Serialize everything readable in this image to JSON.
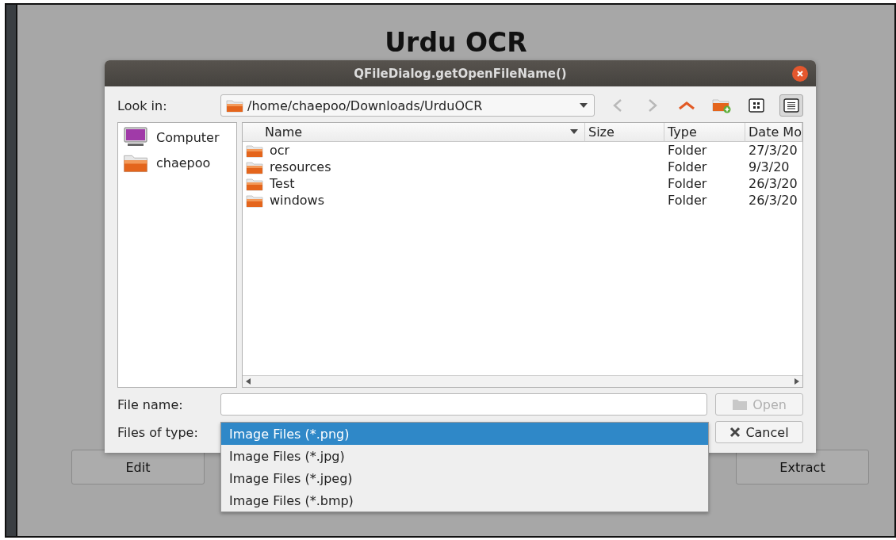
{
  "app": {
    "title": "Urdu OCR",
    "buttons": [
      {
        "label": "Edit"
      },
      {
        "label": "Extract"
      }
    ]
  },
  "dialog": {
    "title": "QFileDialog.getOpenFileName()",
    "look_in": {
      "label": "Look in:",
      "path": "/home/chaepoo/Downloads/UrduOCR"
    },
    "tools": [
      {
        "kind": "back",
        "disabled": true
      },
      {
        "kind": "forward",
        "disabled": true
      },
      {
        "kind": "up",
        "disabled": false
      },
      {
        "kind": "new-folder",
        "disabled": false
      },
      {
        "kind": "icon-view",
        "selected": false
      },
      {
        "kind": "detail-view",
        "selected": true
      }
    ],
    "places": [
      {
        "kind": "computer",
        "label": "Computer"
      },
      {
        "kind": "folder",
        "label": "chaepoo"
      }
    ],
    "columns": [
      "Name",
      "Size",
      "Type",
      "Date Mo"
    ],
    "rows": [
      {
        "name": "ocr",
        "type": "Folder",
        "date": "27/3/20"
      },
      {
        "name": "resources",
        "type": "Folder",
        "date": "9/3/20"
      },
      {
        "name": "Test",
        "type": "Folder",
        "date": "26/3/20"
      },
      {
        "name": "windows",
        "type": "Folder",
        "date": "26/3/20"
      }
    ],
    "file_name": {
      "label": "File name:"
    },
    "files_of_type": {
      "label": "Files of type:",
      "options": [
        {
          "label": "Image Files (*.png)",
          "selected": true
        },
        {
          "label": "Image Files (*.jpg)",
          "selected": false
        },
        {
          "label": "Image Files (*.jpeg)",
          "selected": false
        },
        {
          "label": "Image Files (*.bmp)",
          "selected": false
        }
      ]
    },
    "buttons": [
      {
        "kind": "open",
        "label": "Open",
        "disabled": true
      },
      {
        "kind": "cancel",
        "label": "Cancel",
        "disabled": false
      }
    ]
  }
}
